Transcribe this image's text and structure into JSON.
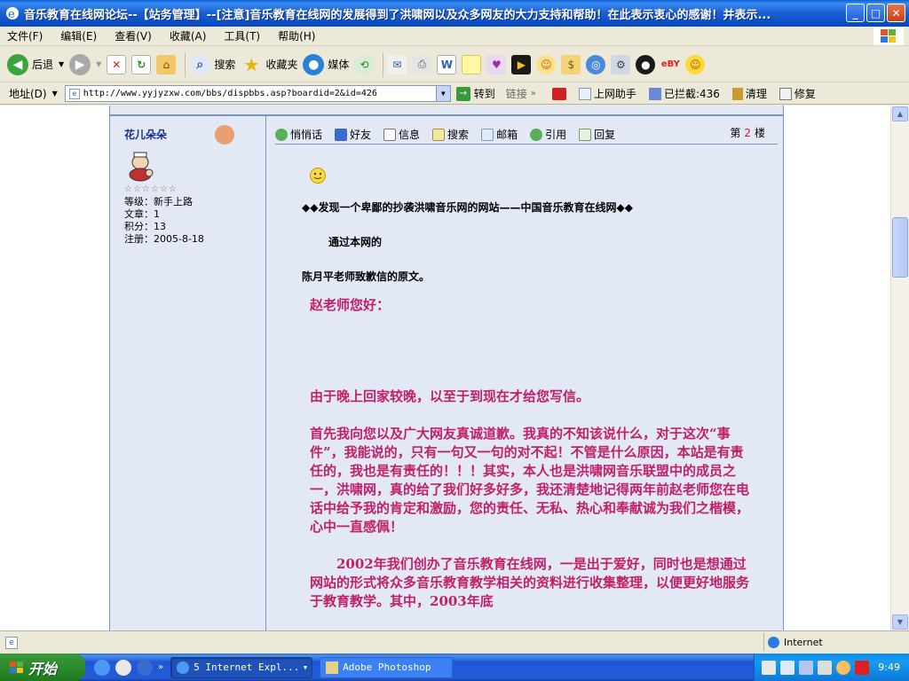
{
  "window": {
    "title": "音乐教育在线网论坛--【站务管理】--[注意]音乐教育在线网的发展得到了洪啸网以及众多网友的大力支持和帮助！在此表示衷心的感谢！并表示...",
    "min": "_",
    "max": "□",
    "close": "✕"
  },
  "menu": [
    "文件(F)",
    "编辑(E)",
    "查看(V)",
    "收藏(A)",
    "工具(T)",
    "帮助(H)"
  ],
  "toolbar": {
    "back": "后退",
    "search": "搜索",
    "favorites": "收藏夹",
    "media": "媒体"
  },
  "address": {
    "label": "地址(D)",
    "url": "http://www.yyjyzxw.com/bbs/dispbbs.asp?boardid=2&id=426",
    "go": "转到",
    "links": "链接",
    "helper": "上网助手",
    "blocked": "已拦截:436",
    "clean": "清理",
    "repair": "修复"
  },
  "user": {
    "name": "花儿朵朵",
    "stars": "☆☆☆☆☆☆",
    "level": "等级：新手上路",
    "posts": "文章：1",
    "points": "积分：13",
    "registered": "注册：2005-8-18"
  },
  "actions": [
    "悄悄话",
    "好友",
    "信息",
    "搜索",
    "邮箱",
    "引用",
    "回复"
  ],
  "floor": {
    "prefix": "第",
    "num": "2",
    "suffix": "楼"
  },
  "post": {
    "headline": "◆◆发现一个卑鄙的抄袭洪啸音乐网的网站——中国音乐教育在线网◆◆",
    "line2": "通过本网的",
    "line3": "陈月平老师致歉信的原文。",
    "greeting": "赵老师您好：",
    "p1": "由于晚上回家较晚，以至于到现在才给您写信。",
    "p2": "首先我向您以及广大网友真诚道歉。我真的不知该说什么，对于这次“事件”，我能说的，只有一句又一句的对不起！不管是什么原因，本站是有责任的，我也是有责任的！！！其实，本人也是洪啸网音乐联盟中的成员之一，洪啸网，真的给了我们好多好多，我还清楚地记得两年前赵老师您在电话中给予我的肯定和激励，您的责任、无私、热心和奉献诚为我们之楷模，心中一直感佩！",
    "p3": "　　2002年我们创办了音乐教育在线网，一是出于爱好，同时也是想通过网站的形式将众多音乐教育教学相关的资料进行收集整理，以便更好地服务于教育教学。其中，2003年底"
  },
  "status": {
    "zone": "Internet"
  },
  "taskbar": {
    "start": "开始",
    "task1": "5 Internet Expl...",
    "task2": "Adobe Photoshop",
    "clock": "9:49"
  },
  "colors": {
    "accent": "#c21f6a",
    "username": "#1a2f8c",
    "frame": "#7c93c5"
  }
}
